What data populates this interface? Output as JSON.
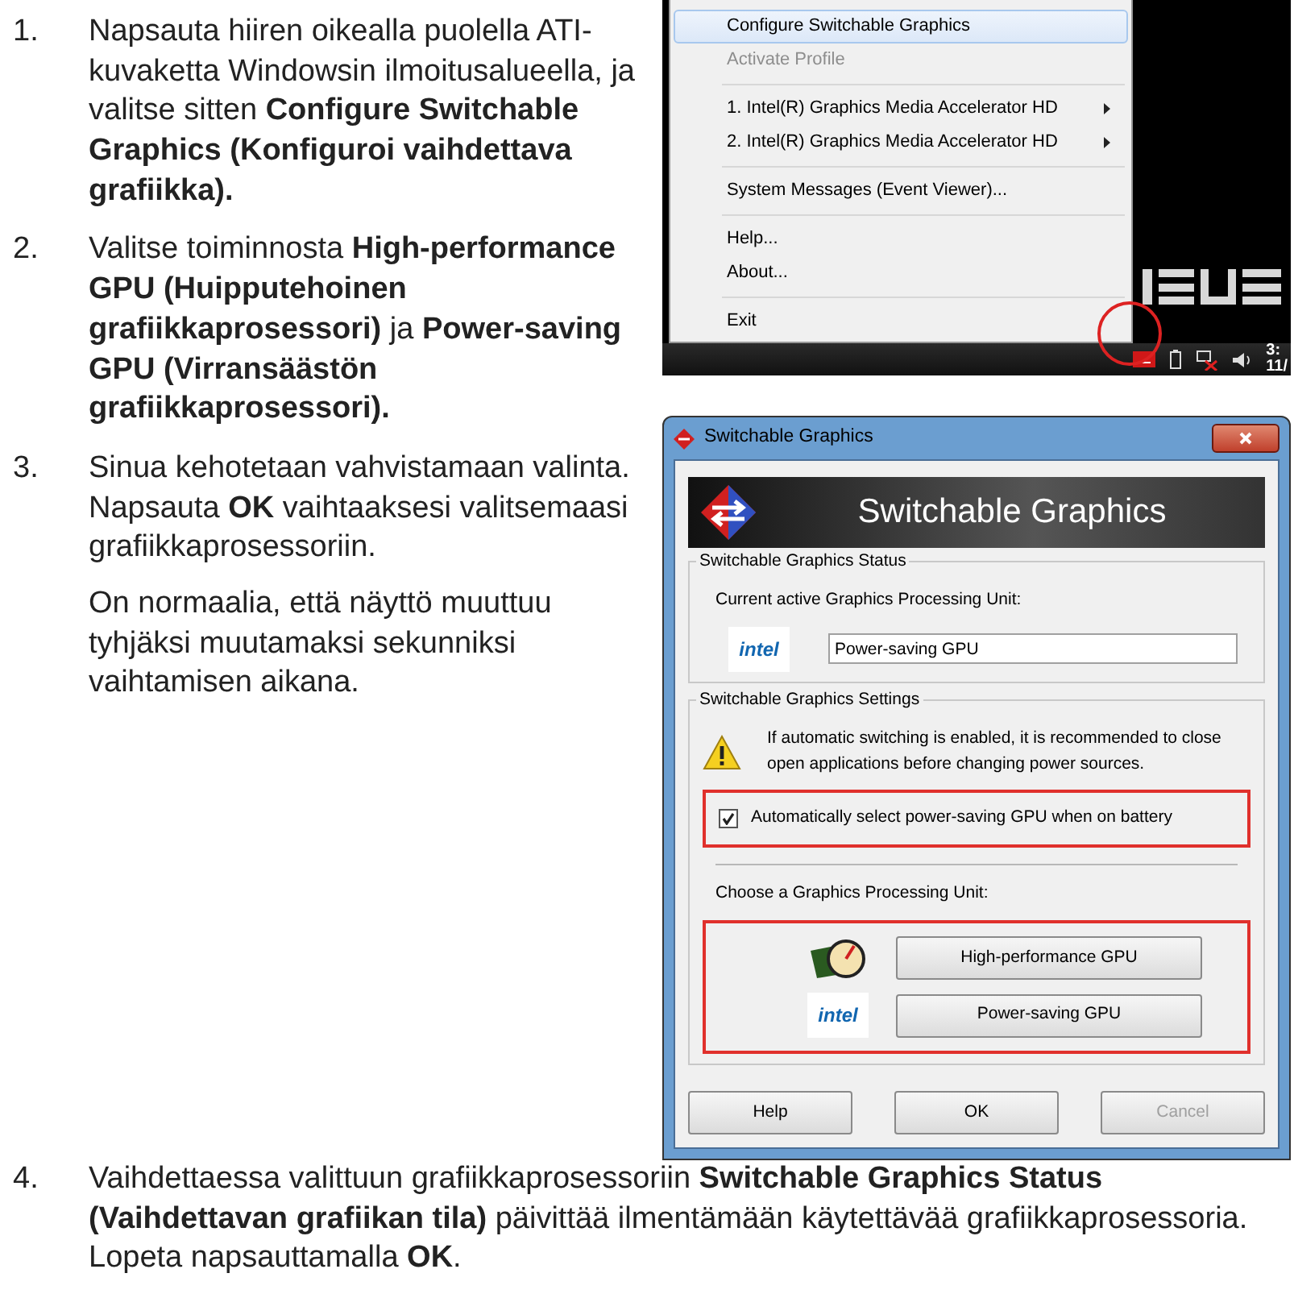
{
  "instructions": {
    "steps": [
      {
        "number": "1.",
        "text": "Napsauta hiiren oikealla puolella ATI-kuvaketta Windowsin ilmoitusalueella, ja valitse sitten **Configure Switchable Graphics (Konfiguroi vaihdettava grafiikka).**"
      },
      {
        "number": "2.",
        "text": "Valitse toiminnosta **High-performance GPU (Huipputehoinen grafiikkaprosessori)** ja **Power-saving GPU (Virransäästön grafiikkaprosessori).**"
      },
      {
        "number": "3.",
        "text": "Sinua kehotetaan vahvistamaan valinta. Napsauta **OK** vaihtaaksesi valitsemaasi grafiikkaprosessoriin.",
        "note": "On normaalia, että näyttö muuttuu tyhjäksi muutamaksi sekunniksi vaihtamisen aikana."
      },
      {
        "number": "4.",
        "text": "Vaihdettaessa valittuun grafiikkaprosessoriin **Switchable Graphics Status (Vaihdettavan grafiikan tila)** päivittää ilmentämään käytettävää grafiikkaprosessoria. Lopeta napsauttamalla **OK**."
      }
    ]
  },
  "context_menu": {
    "items": [
      {
        "kind": "item",
        "label": "Configure Switchable Graphics",
        "selected": true,
        "disabled": false
      },
      {
        "kind": "item",
        "label": "Activate Profile",
        "selected": false,
        "disabled": true
      },
      {
        "kind": "separator"
      },
      {
        "kind": "submenu",
        "label": "1. Intel(R) Graphics Media Accelerator HD",
        "selected": false,
        "disabled": false
      },
      {
        "kind": "submenu",
        "label": "2. Intel(R) Graphics Media Accelerator HD",
        "selected": false,
        "disabled": false
      },
      {
        "kind": "separator"
      },
      {
        "kind": "item",
        "label": "System Messages (Event Viewer)...",
        "selected": false,
        "disabled": false
      },
      {
        "kind": "separator"
      },
      {
        "kind": "item",
        "label": "Help...",
        "selected": false,
        "disabled": false
      },
      {
        "kind": "item",
        "label": "About...",
        "selected": false,
        "disabled": false
      },
      {
        "kind": "separator"
      },
      {
        "kind": "item",
        "label": "Exit",
        "selected": false,
        "disabled": false
      }
    ]
  },
  "taskbar": {
    "clock_time": "3:",
    "clock_date": "11/"
  },
  "dialog": {
    "title": "Switchable Graphics",
    "banner_title": "Switchable Graphics",
    "status_group": {
      "legend": "Switchable Graphics Status",
      "label": "Current active Graphics Processing Unit:",
      "logo": "intel",
      "value": "Power-saving GPU"
    },
    "settings_group": {
      "legend": "Switchable Graphics Settings",
      "warning": "If automatic switching is enabled, it is recommended to close open applications before changing power sources.",
      "checkbox": {
        "label": "Automatically select power-saving GPU when on battery",
        "checked": true
      },
      "choose_label": "Choose a Graphics Processing Unit:",
      "gpu_options": [
        {
          "kind": "high-performance",
          "label": "High-performance GPU"
        },
        {
          "kind": "power-saving",
          "logo": "intel",
          "label": "Power-saving GPU"
        }
      ]
    },
    "buttons": [
      {
        "label": "Help",
        "disabled": false
      },
      {
        "label": "OK",
        "disabled": false
      },
      {
        "label": "Cancel",
        "disabled": true
      }
    ]
  }
}
